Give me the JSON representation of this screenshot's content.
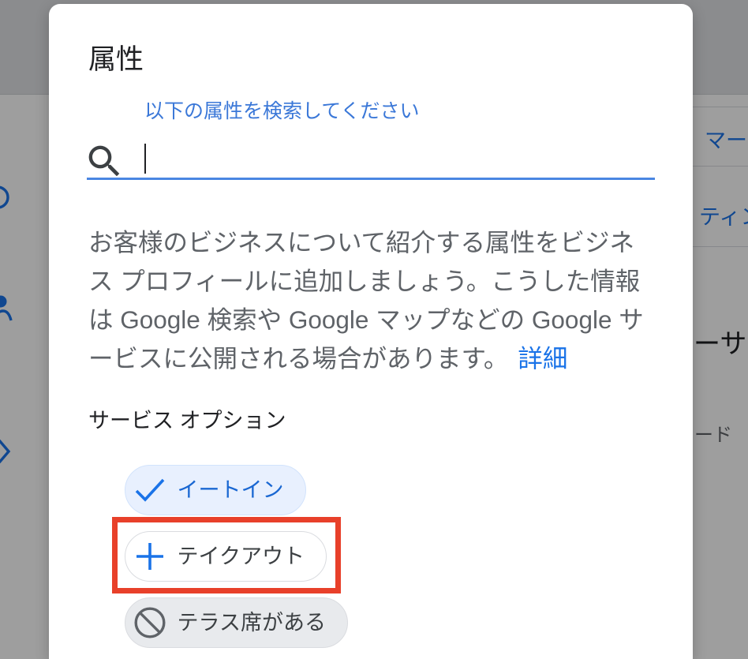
{
  "backdrop": {
    "side_icons": [
      "chat-icon",
      "person-icon",
      "chevron-right-icon"
    ],
    "right_panel": {
      "items": [
        "マーケ",
        "ティン"
      ],
      "heading": "ーサ",
      "subtext": "ード"
    }
  },
  "dialog": {
    "title": "属性",
    "search": {
      "label": "以下の属性を検索してください",
      "value": "",
      "icon": "search-icon"
    },
    "description": {
      "lines": [
        "お客様のビジネスについて紹介する属性をビジネ",
        "ス プロフィールに追加しましょう。こうした情報",
        "は Google 検索や Google マップなどの Google サ",
        "ービスに公開される場合があります。"
      ],
      "link_label": "詳細"
    },
    "section_title": "サービス オプション",
    "options": [
      {
        "label": "イートイン",
        "icon": "check-icon",
        "selected": true,
        "excluded": false,
        "highlighted": false
      },
      {
        "label": "テイクアウト",
        "icon": "add-icon",
        "selected": false,
        "excluded": false,
        "highlighted": true
      },
      {
        "label": "テラス席がある",
        "icon": "block-icon",
        "selected": false,
        "excluded": true,
        "highlighted": false
      }
    ]
  },
  "colors": {
    "accent": "#1a73e8",
    "highlight_box": "#e8402a",
    "selected_chip_background": "#e8f0fe",
    "excluded_chip_background": "#e8eaed"
  }
}
